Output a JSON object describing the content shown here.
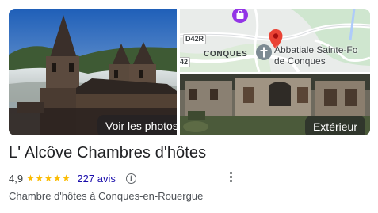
{
  "photos": {
    "main_button_label": "Voir les photos",
    "exterior_button_label": "Extérieur"
  },
  "map": {
    "town_label": "CONQUES",
    "road_label_top": "D42R",
    "road_label_side": "42",
    "place_line1": "Abbatiale Sainte-Fo",
    "place_line2": "de Conques",
    "pin_color": "#ea4335"
  },
  "place": {
    "name": "L' Alcôve Chambres d'hôtes",
    "rating": "4,9",
    "stars": 5,
    "reviews_label": "227 avis",
    "category": "Chambre d'hôtes à Conques-en-Rouergue"
  },
  "colors": {
    "star": "#fbbc04",
    "link": "#1a0dab",
    "title": "#202124"
  },
  "icons": {
    "info": "info-icon",
    "more": "more-vert-icon",
    "map_pin": "map-pin-icon",
    "church": "church-icon",
    "shopping": "shopping-bag-icon"
  }
}
